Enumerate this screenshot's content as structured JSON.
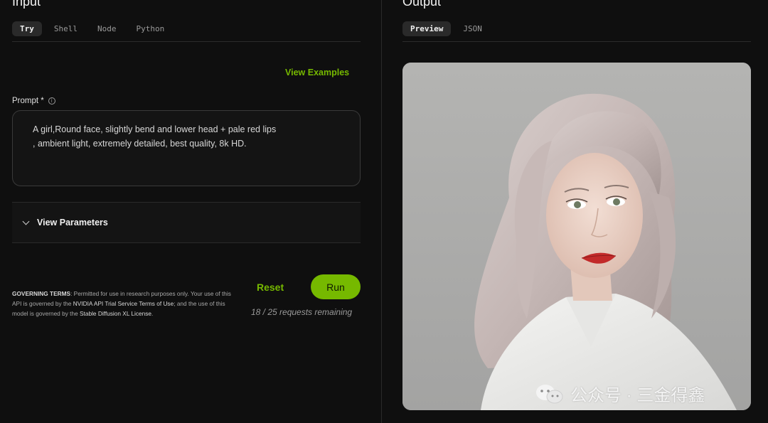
{
  "input": {
    "title": "Input",
    "tabs": [
      "Try",
      "Shell",
      "Node",
      "Python"
    ],
    "active_tab": "Try",
    "view_examples": "View Examples",
    "prompt_label": "Prompt *",
    "prompt_value": "A girl,Round face, slightly bend and lower head + pale red lips\n, ambient light, extremely detailed, best quality, 8k HD.",
    "view_parameters": "View Parameters",
    "terms": {
      "heading": "GOVERNING TERMS",
      "text_1": ": Permitted for use in research purposes only. Your use of this API is governed by the ",
      "link_1": "NVIDIA API Trial Service Terms of Use",
      "text_2": "; and the use of this model is governed by the ",
      "link_2": "Stable Diffusion XL License",
      "text_3": "."
    },
    "reset_label": "Reset",
    "run_label": "Run",
    "remaining": "18 / 25 requests remaining"
  },
  "output": {
    "title": "Output",
    "tabs": [
      "Preview",
      "JSON"
    ],
    "active_tab": "Preview"
  },
  "watermark": {
    "text": "公众号 · 三金得鑫",
    "icon": "wechat-icon"
  },
  "colors": {
    "accent": "#76b900",
    "background": "#0f0f0f"
  }
}
